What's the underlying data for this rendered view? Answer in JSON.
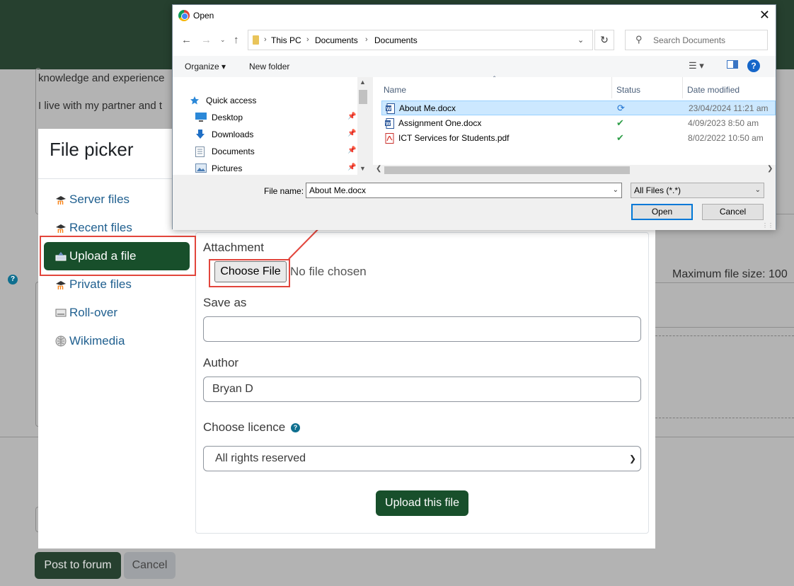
{
  "background_page": {
    "text_line1": "knowledge and experience",
    "text_line2": "I live with my partner and t",
    "max_file_size": "Maximum file size: 100",
    "post_button": "Post to forum",
    "cancel_button": "Cancel",
    "help_glyph": "?"
  },
  "file_picker": {
    "title": "File picker",
    "repositories": [
      {
        "label": "Server files",
        "icon": "moodle-icon"
      },
      {
        "label": "Recent files",
        "icon": "moodle-icon"
      },
      {
        "label": "Upload a file",
        "icon": "upload-icon",
        "active": true
      },
      {
        "label": "Private files",
        "icon": "moodle-icon"
      },
      {
        "label": "Roll-over",
        "icon": "rollover-icon"
      },
      {
        "label": "Wikimedia",
        "icon": "wikimedia-icon"
      }
    ],
    "attachment_label": "Attachment",
    "choose_file_button": "Choose File",
    "no_file_text": "No file chosen",
    "save_as_label": "Save as",
    "save_as_value": "",
    "author_label": "Author",
    "author_value": "Bryan D",
    "licence_label": "Choose licence",
    "licence_value": "All rights reserved",
    "upload_button": "Upload this file",
    "highlight_color": "#e2453c",
    "accent_color": "#184f2b"
  },
  "open_dialog": {
    "title": "Open",
    "close_glyph": "✕",
    "breadcrumb": [
      "This PC",
      "Documents",
      "Documents"
    ],
    "search_placeholder": "Search Documents",
    "toolbar": {
      "organize": "Organize ▾",
      "new_folder": "New folder"
    },
    "nav_items": [
      {
        "label": "Quick access",
        "icon": "star-icon"
      },
      {
        "label": "Desktop",
        "icon": "desktop-icon",
        "pinned": true
      },
      {
        "label": "Downloads",
        "icon": "download-icon",
        "pinned": true
      },
      {
        "label": "Documents",
        "icon": "documents-icon",
        "pinned": true
      },
      {
        "label": "Pictures",
        "icon": "pictures-icon",
        "pinned": true
      }
    ],
    "columns": {
      "name": "Name",
      "status": "Status",
      "date": "Date modified"
    },
    "files": [
      {
        "name": "About Me.docx",
        "status": "sync-icon",
        "date": "23/04/2024 11:21 am",
        "type": "word",
        "selected": true
      },
      {
        "name": "Assignment One.docx",
        "status": "check-icon",
        "date": "4/09/2023 8:50 am",
        "type": "word",
        "selected": false
      },
      {
        "name": "ICT Services for Students.pdf",
        "status": "check-icon",
        "date": "8/02/2022 10:50 am",
        "type": "pdf",
        "selected": false
      }
    ],
    "file_name_label": "File name:",
    "file_name_value": "About Me.docx",
    "file_type_value": "All Files (*.*)",
    "open_button": "Open",
    "cancel_button": "Cancel"
  }
}
